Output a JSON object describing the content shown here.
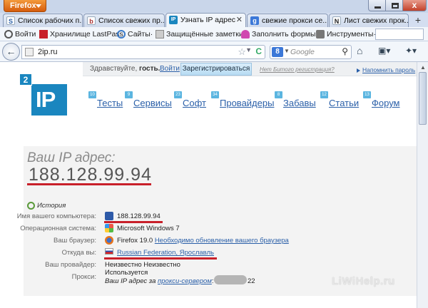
{
  "browser": {
    "menu_label": "Firefox",
    "window_close": "x"
  },
  "tabs": [
    {
      "label": "Список рабочих п...",
      "favicon": "S"
    },
    {
      "label": "Список свежих пр...",
      "favicon": "b"
    },
    {
      "label": "Узнать IP адрес",
      "favicon": "IP"
    },
    {
      "label": "свежие прокси се...",
      "favicon": "g"
    },
    {
      "label": "Лист свежих прок...",
      "favicon": "N"
    }
  ],
  "new_tab": "+",
  "bookmarks": [
    {
      "label": "Войти"
    },
    {
      "label": "Хранилище LastPass"
    },
    {
      "label": "Сайты·"
    },
    {
      "label": "Защищённые заметки·"
    },
    {
      "label": "Заполнить формы·"
    },
    {
      "label": "Инструменты·"
    }
  ],
  "nav": {
    "url": "2ip.ru",
    "search_placeholder": "Google"
  },
  "site": {
    "greeting_prefix": "Здравствуйте,",
    "greeting_user": "гость.",
    "login": "Войти",
    "register": "Зарегистрироваться",
    "forgot": "Нет Битого регистрация?",
    "remind": "Напомнить пароль",
    "logo_num": "2",
    "logo_text": "IP",
    "menu": [
      {
        "label": "Тесты",
        "icon": "10"
      },
      {
        "label": "Сервисы",
        "icon": "9"
      },
      {
        "label": "Софт",
        "icon": "23"
      },
      {
        "label": "Провайдеры",
        "icon": "34"
      },
      {
        "label": "Забавы",
        "icon": "8"
      },
      {
        "label": "Статьи",
        "icon": "12"
      },
      {
        "label": "Форум",
        "icon": "13"
      }
    ]
  },
  "ip_info": {
    "heading": "Ваш IP адрес:",
    "address": "188.128.99.94",
    "history": "История",
    "rows": [
      {
        "label": "Имя вашего компьютера:",
        "value": "188.128.99.94"
      },
      {
        "label": "Операционная система:",
        "value": "Microsoft Windows 7"
      },
      {
        "label": "Ваш браузер:",
        "value": "Firefox 19.0",
        "link": "Необходимо обновление вашего браузера"
      },
      {
        "label": "Откуда вы:",
        "link": "Russian Federation, Ярославль"
      },
      {
        "label": "Ваш провайдер:",
        "value": "Неизвестно Неизвестно"
      },
      {
        "label": "Прокси:",
        "value": "Используется"
      }
    ],
    "proxy_prefix": "Ваш IP адрес за",
    "proxy_link": "прокси-сервером",
    "proxy_ip_start": ": 7",
    "proxy_ip_end": "22"
  },
  "watermark": "LiWiHelp.ru"
}
